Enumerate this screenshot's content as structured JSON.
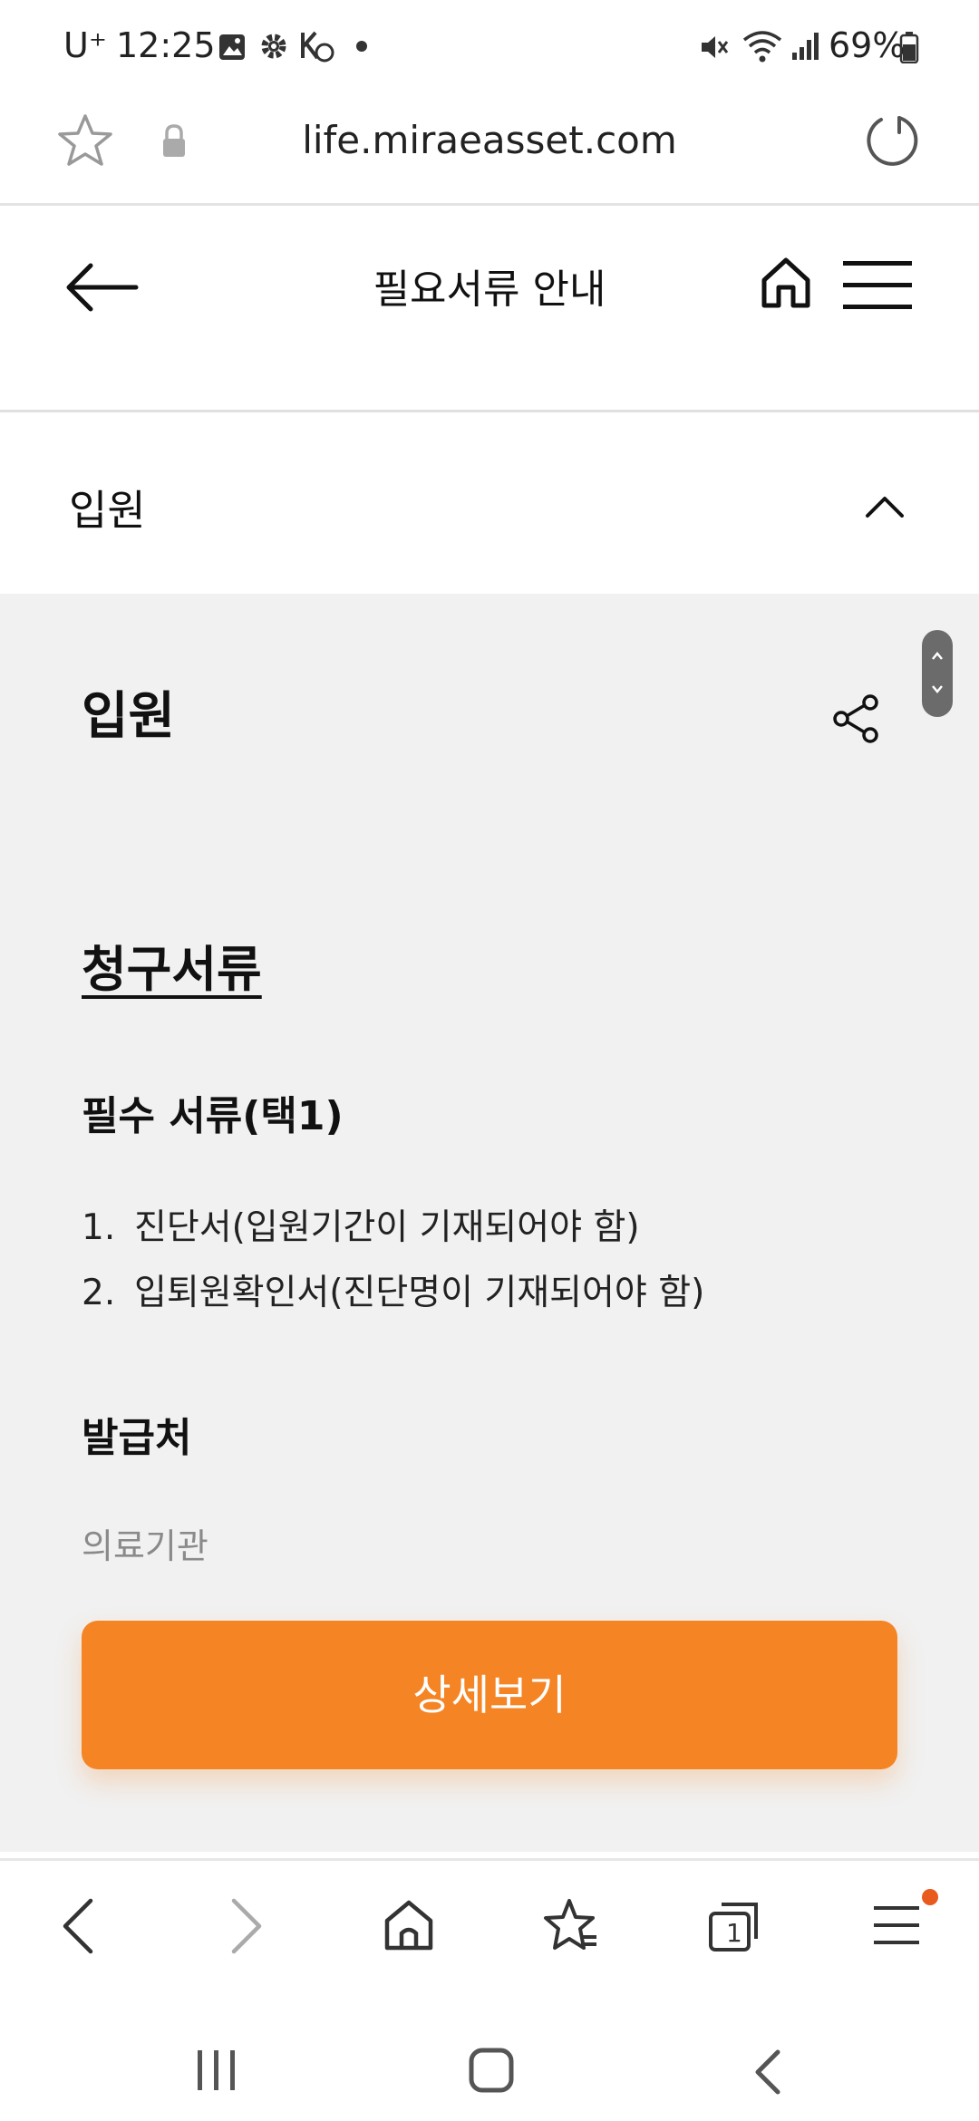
{
  "status_bar": {
    "carrier": "U⁺",
    "time": "12:25",
    "battery": "69%"
  },
  "browser": {
    "url": "life.miraeasset.com"
  },
  "header": {
    "title": "필요서류 안내"
  },
  "accordion": {
    "label": "입원"
  },
  "content": {
    "heading": "입원",
    "section_title": "청구서류",
    "required_title": "필수 서류(택1)",
    "items": [
      {
        "num": "1.",
        "text": "진단서(입원기간이 기재되어야 함)"
      },
      {
        "num": "2.",
        "text": "입퇴원확인서(진단명이 기재되어야 함)"
      }
    ],
    "issuer_title": "발급처",
    "issuer_value": "의료기관",
    "detail_button": "상세보기"
  },
  "toolbar": {
    "tab_count": "1"
  },
  "colors": {
    "accent": "#f58424",
    "background": "#f1f1f1",
    "notification_dot": "#e85a1e"
  }
}
